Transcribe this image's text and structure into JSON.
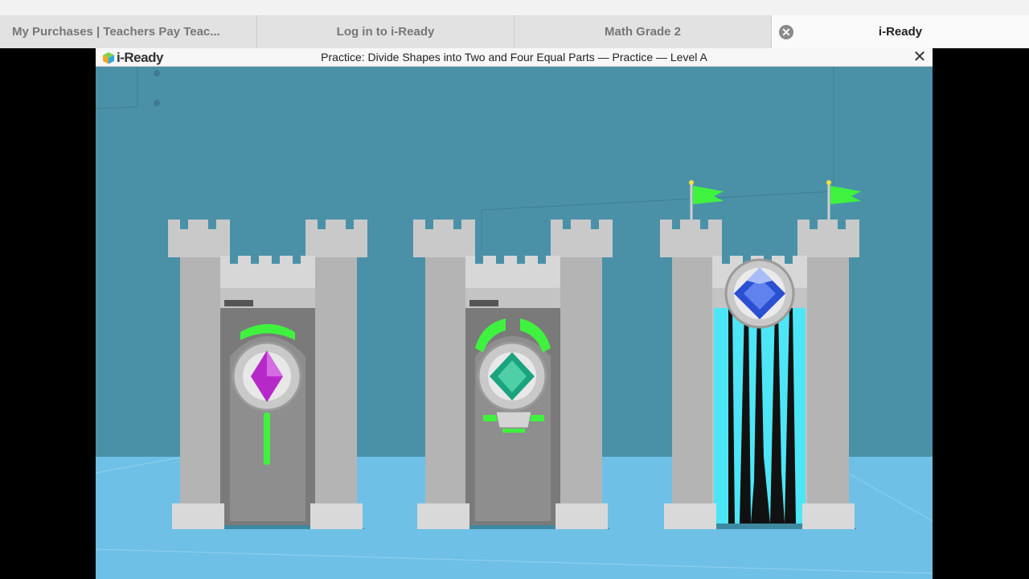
{
  "browser": {
    "tabs": [
      {
        "label": "My Purchases | Teachers Pay Teac..."
      },
      {
        "label": "Log in to i-Ready"
      },
      {
        "label": "Math Grade 2"
      },
      {
        "label": "i-Ready"
      }
    ]
  },
  "header": {
    "logo_text": "i-Ready",
    "title": "Practice: Divide Shapes into Two and Four Equal Parts — Practice — Level A"
  },
  "scene": {
    "castles": [
      {
        "gem_color": "#b629c9",
        "state": "locked"
      },
      {
        "gem_color": "#1aa37e",
        "state": "locked"
      },
      {
        "gem_color": "#2a4fd1",
        "state": "open"
      }
    ],
    "colors": {
      "wall": "#4a91a8",
      "floor": "#6fc0e6",
      "stone": "#bfbfbf",
      "light": "#3ff23f",
      "portal": "#4de6f7"
    }
  }
}
